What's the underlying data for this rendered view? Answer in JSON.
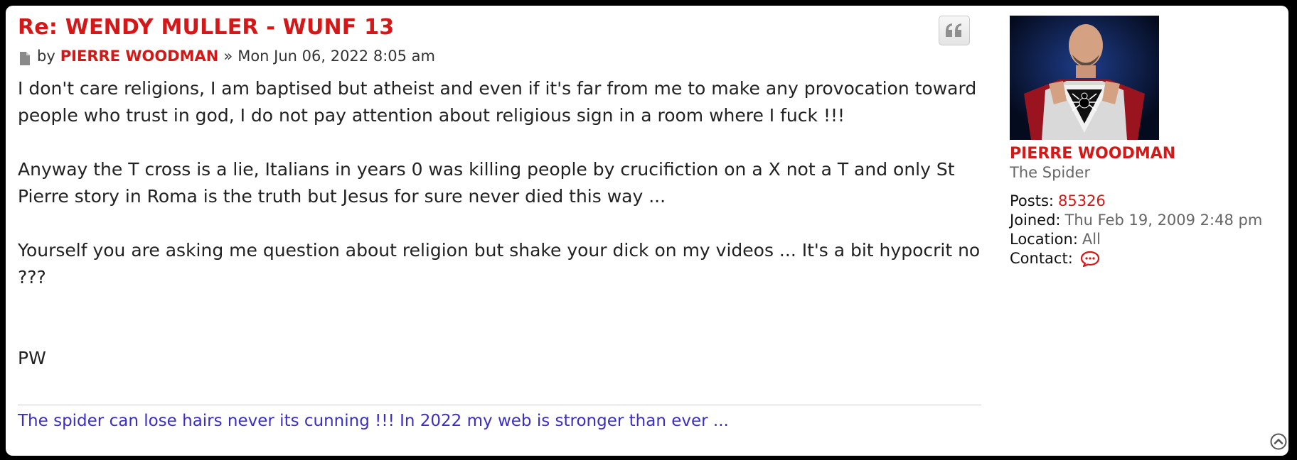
{
  "post": {
    "title": "Re: WENDY MULLER - WUNF 13",
    "by_label": "by",
    "author": "PIERRE WOODMAN",
    "separator": "»",
    "date": "Mon Jun 06, 2022 8:05 am",
    "paragraphs": [
      "I don't care religions, I am baptised but atheist and even if it's far from me to make any provocation toward people who trust in god, I do not pay attention about religious sign in a room where I fuck !!!",
      "Anyway the T cross is a lie, Italians in years 0 was killing people by crucifiction on a X not a T and only St Pierre story in Roma is the truth but Jesus for sure never died this way ...",
      "Yourself you are asking me question about religion but shake your dick on my videos ... It's a bit hypocrit no ???",
      "PW"
    ],
    "signature": "The spider can lose hairs never its cunning !!! In 2022 my web is stronger than ever ..."
  },
  "profile": {
    "name": "PIERRE WOODMAN",
    "rank": "The Spider",
    "posts_label": "Posts:",
    "posts_value": "85326",
    "joined_label": "Joined:",
    "joined_value": "Thu Feb 19, 2009 2:48 pm",
    "location_label": "Location:",
    "location_value": "All",
    "contact_label": "Contact:"
  },
  "icons": {
    "post": "document-icon",
    "quote": "quote-icon",
    "contact": "speech-bubble-icon",
    "top": "chevron-up-circle-icon"
  },
  "colors": {
    "title": "#d41717",
    "link": "#d41717",
    "signature": "#3b2fc2",
    "background": "#000000",
    "panel": "#ffffff"
  }
}
